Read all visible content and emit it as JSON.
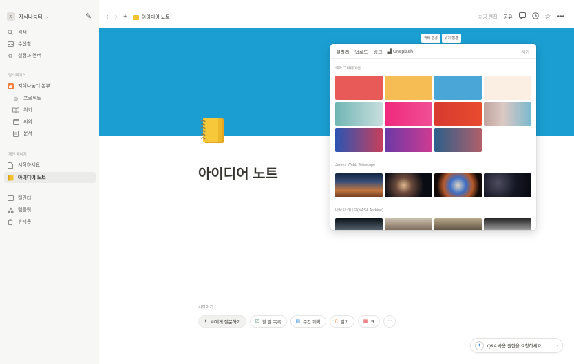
{
  "sidebar": {
    "workspace": {
      "badge": "지",
      "name": "지식나눔터"
    },
    "top_items": [
      {
        "label": "검색",
        "icon": "search-icon"
      },
      {
        "label": "수신함",
        "icon": "inbox-icon"
      },
      {
        "label": "설정과 멤버",
        "icon": "gear-icon"
      }
    ],
    "teamspace_label": "팀스페이스",
    "teamspace": {
      "label": "지식나눔터 본부",
      "icon": "home-icon"
    },
    "team_items": [
      {
        "label": "프로젝트",
        "icon": "target-icon"
      },
      {
        "label": "위키",
        "icon": "book-icon"
      },
      {
        "label": "회의",
        "icon": "calendar-icon"
      },
      {
        "label": "문서",
        "icon": "document-icon"
      }
    ],
    "private_label": "개인 페이지",
    "private_items": [
      {
        "label": "시작하세요",
        "icon": "page-icon"
      },
      {
        "label": "아이디어 노트",
        "icon": "notebook-icon"
      }
    ],
    "bottom_items": [
      {
        "label": "캘린더",
        "icon": "calendar-icon"
      },
      {
        "label": "템플릿",
        "icon": "shapes-icon"
      },
      {
        "label": "휴지통",
        "icon": "trash-icon"
      }
    ]
  },
  "topbar": {
    "breadcrumb": "아이디어 노트",
    "edited": "지금 편집",
    "share": "공유"
  },
  "cover": {
    "color": "#1b9fd2",
    "change_cover": "커버 변경",
    "reposition": "위치 변경"
  },
  "page": {
    "title": "아이디어 노트"
  },
  "picker": {
    "tabs": [
      "갤러리",
      "업로드",
      "링크",
      "Unsplash"
    ],
    "remove": "제거",
    "sections": {
      "colors": "색과 그라데이션",
      "webb": "James Webb Telescope",
      "nasa": "나사 아카이브(NASA Archive)"
    },
    "swatches": [
      {
        "css": "#e85a57"
      },
      {
        "css": "#f6bd55"
      },
      {
        "css": "#4aa6d6"
      },
      {
        "css": "#fbeee3"
      },
      {
        "css": "linear-gradient(90deg,#6fb6b3,#c9dede)"
      },
      {
        "css": "linear-gradient(90deg,#f0287c,#f04f96)"
      },
      {
        "css": "linear-gradient(90deg,#d73a2f,#e84b2e)"
      },
      {
        "css": "linear-gradient(90deg,#bfa39d,#dcc8c3 40%,#7ab9cf)"
      },
      {
        "css": "linear-gradient(90deg,#2b55b4,#c73f5c)"
      },
      {
        "css": "linear-gradient(90deg,#6a3aa6,#cf3a92)"
      },
      {
        "css": "linear-gradient(90deg,#2c5f8a,#b05f6a)"
      }
    ],
    "webb_photos": [
      {
        "css": "linear-gradient(180deg,#12253f 0%,#3a4f78 35%,#c3773f 70%,#6e3a20 100%)"
      },
      {
        "css": "radial-gradient(circle at 40% 50%,#e0b98f 0%,#6c4a3c 25%,#0a0c14 65%)"
      },
      {
        "css": "radial-gradient(circle at 50% 50%,#e1d7c6 0%,#3c6ec4 30%,#b85a2b 55%,#120a08 80%)"
      },
      {
        "css": "radial-gradient(circle at 30% 40%,#4d4c60 0%,#151724 50%,#07080d 100%)"
      }
    ],
    "nasa_photos": [
      {
        "css": "linear-gradient(180deg,#0d1218,#6d8090 70%,#c1c8cc)"
      },
      {
        "css": "linear-gradient(180deg,#cbbfae,#6f5c4c 60%,#2a2119)"
      },
      {
        "css": "linear-gradient(180deg,#b8a78a,#4e4336 60%,#1e1813)"
      },
      {
        "css": "linear-gradient(180deg,#262626,#9a9a9a 50%,#1b1b1b)"
      }
    ]
  },
  "start": {
    "label": "시작하기",
    "chips": [
      {
        "label": "AI에게 질문하기",
        "icon": "ai-sparkle-icon",
        "glyph": "✦",
        "color": "#37352f"
      },
      {
        "label": "할 일 목록",
        "icon": "checkbox-icon",
        "glyph": "☑",
        "color": "#448361"
      },
      {
        "label": "주간 계획",
        "icon": "calendar-icon",
        "glyph": "▤",
        "color": "#2383e2"
      },
      {
        "label": "읽기",
        "icon": "book-icon",
        "glyph": "▯",
        "color": "#d9730d"
      },
      {
        "label": "표",
        "icon": "table-icon",
        "glyph": "▦",
        "color": "#e03e3e"
      }
    ]
  },
  "qa_banner": {
    "text": "Q&A 사용 권한을 요청하세요."
  }
}
